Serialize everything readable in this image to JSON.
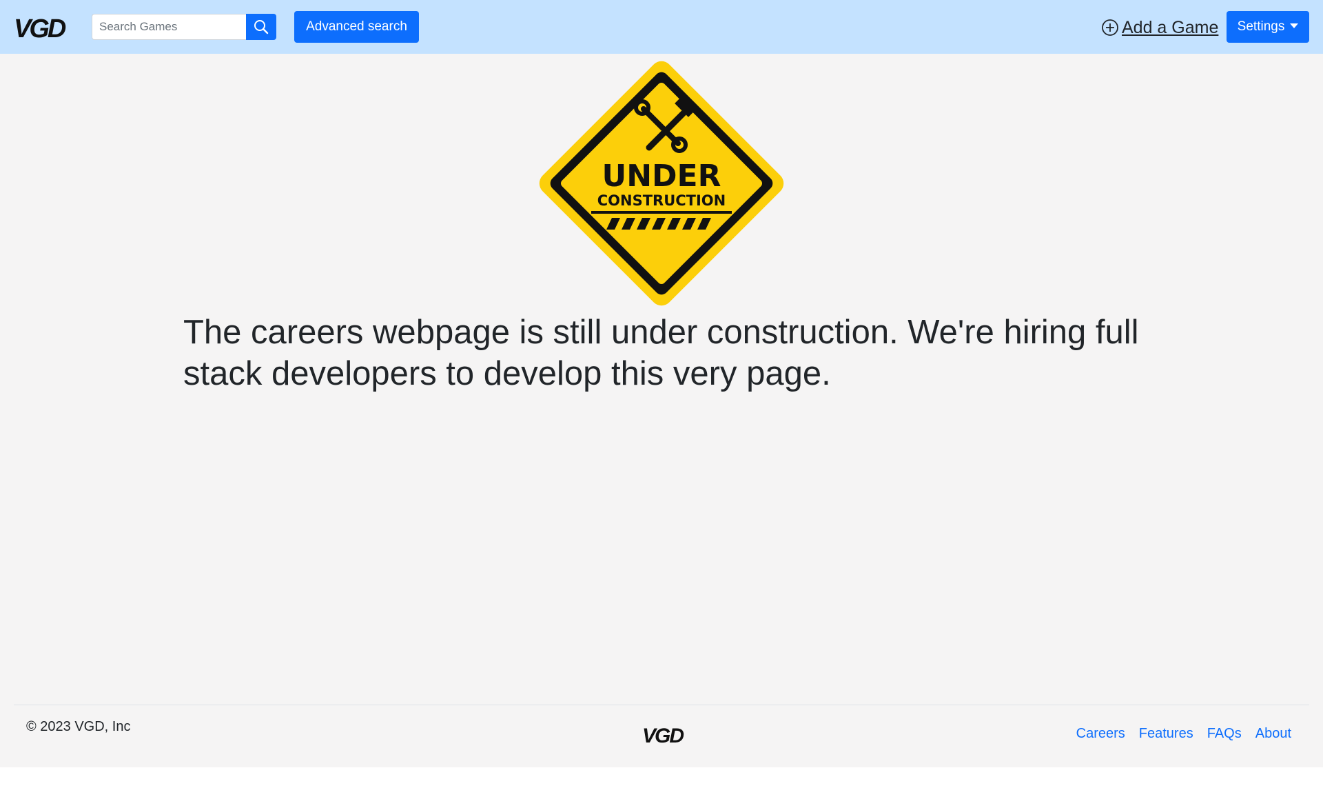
{
  "header": {
    "logo_text": "VGD",
    "search": {
      "placeholder": "Search Games",
      "value": ""
    },
    "advanced_search_label": "Advanced search",
    "add_game_label": "Add a Game",
    "settings_label": "Settings"
  },
  "main": {
    "sign": {
      "line1": "UNDER",
      "line2": "CONSTRUCTION"
    },
    "message": "The careers webpage is still under construction. We're hiring full stack developers to develop this very page."
  },
  "footer": {
    "copyright": "© 2023 VGD, Inc",
    "logo_text": "VGD",
    "links": [
      "Careers",
      "Features",
      "FAQs",
      "About"
    ]
  },
  "colors": {
    "navbar_bg": "#c4e2ff",
    "primary": "#0d6efd",
    "page_bg": "#f5f4f4",
    "sign_yellow": "#fccf0a"
  }
}
